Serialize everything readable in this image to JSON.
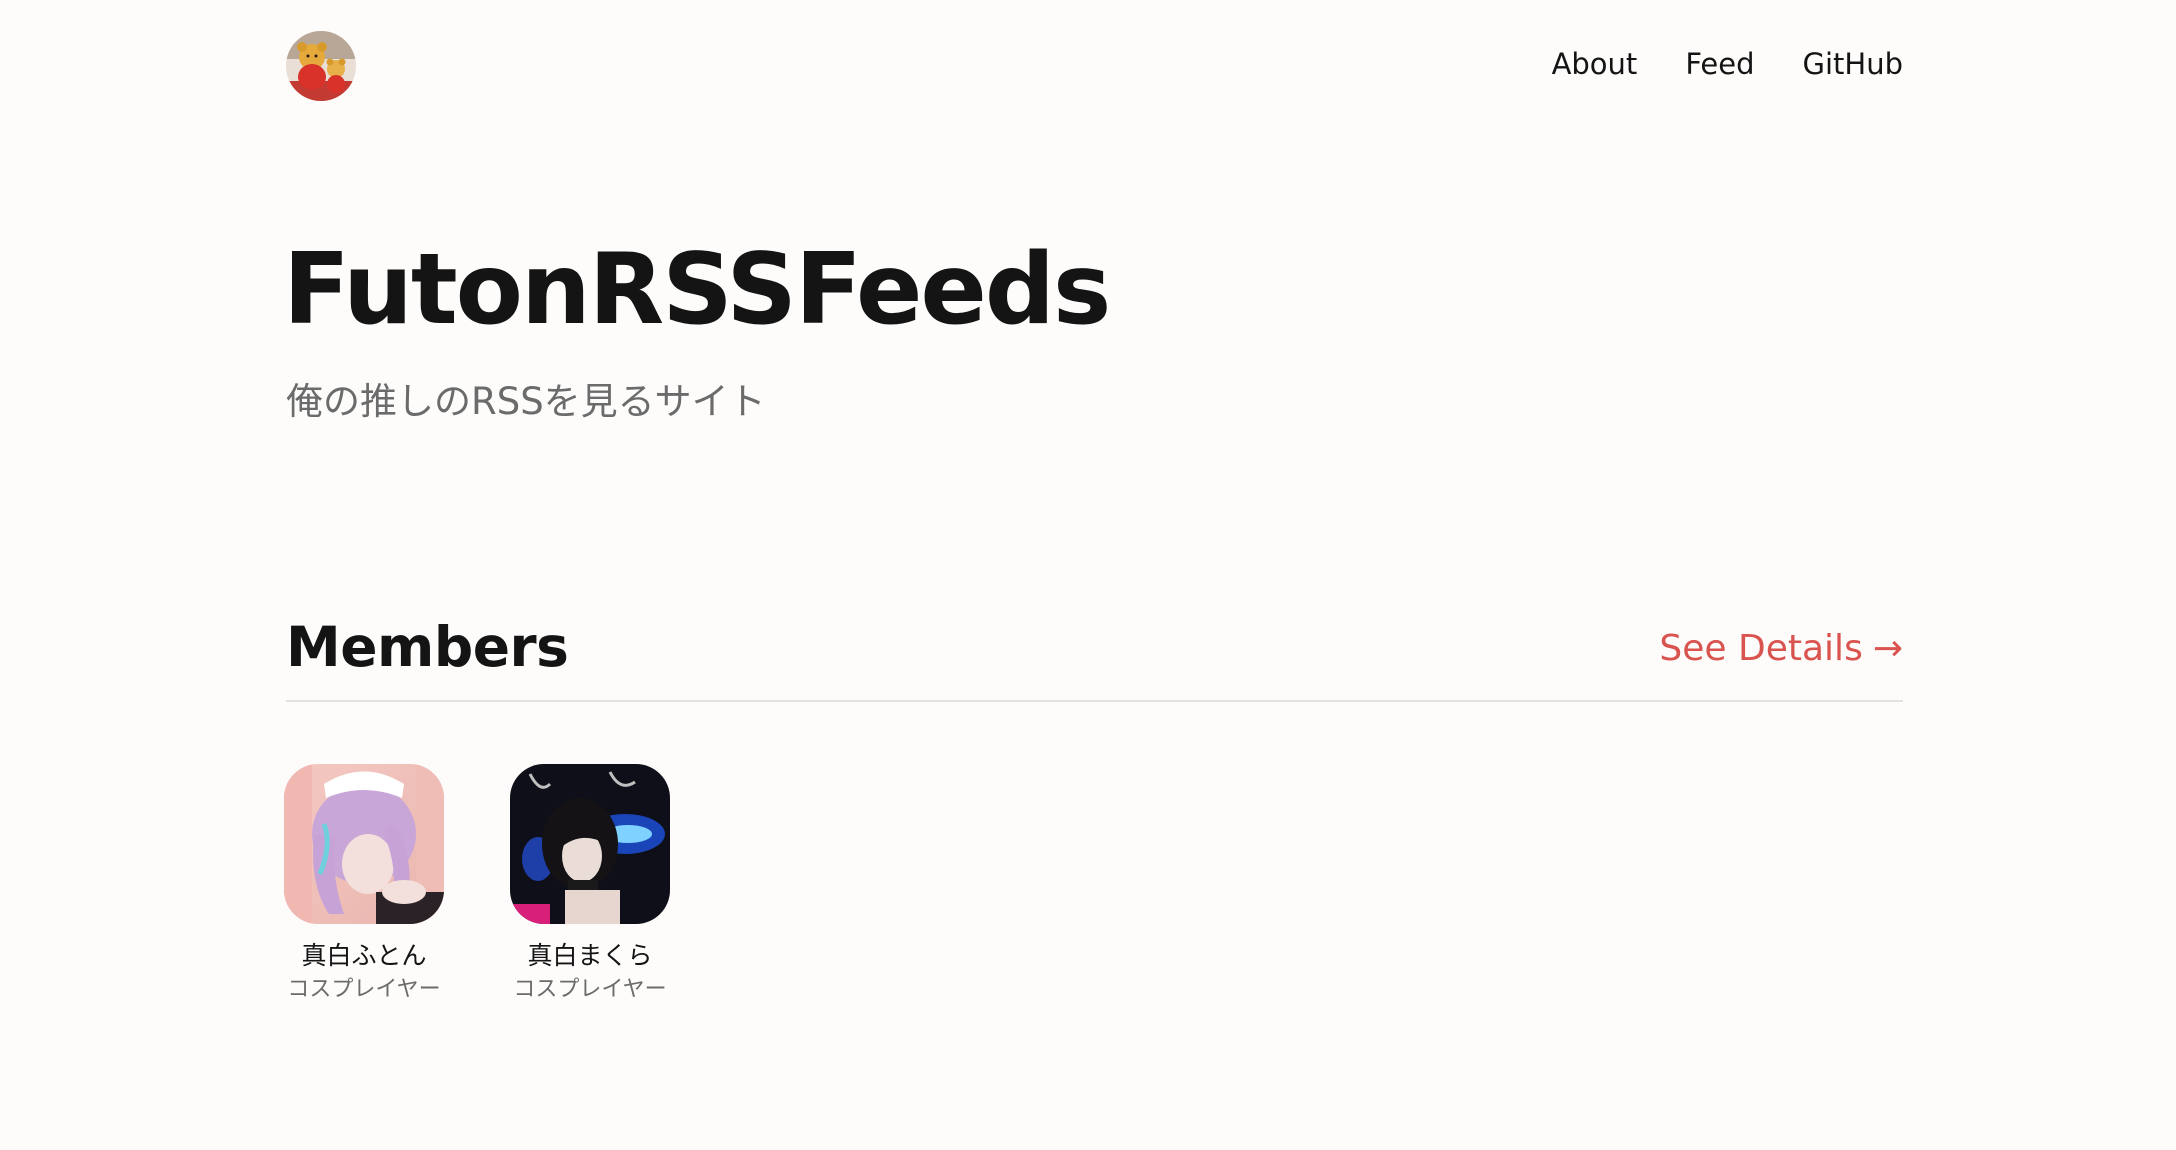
{
  "header": {
    "logo_icon": "bear-plush-avatar-icon",
    "nav": [
      {
        "label": "About"
      },
      {
        "label": "Feed"
      },
      {
        "label": "GitHub"
      }
    ]
  },
  "hero": {
    "title": "FutonRSSFeeds",
    "subtitle": "俺の推しのRSSを見るサイト"
  },
  "members_section": {
    "title": "Members",
    "see_details_label": "See Details",
    "see_details_arrow": "→",
    "accent_color": "#d9534f",
    "members": [
      {
        "name": "真白ふとん",
        "role": "コスプレイヤー",
        "avatar_icon": "purple-hair-cosplayer-avatar"
      },
      {
        "name": "真白まくら",
        "role": "コスプレイヤー",
        "avatar_icon": "dark-hair-cosplayer-avatar"
      }
    ]
  }
}
